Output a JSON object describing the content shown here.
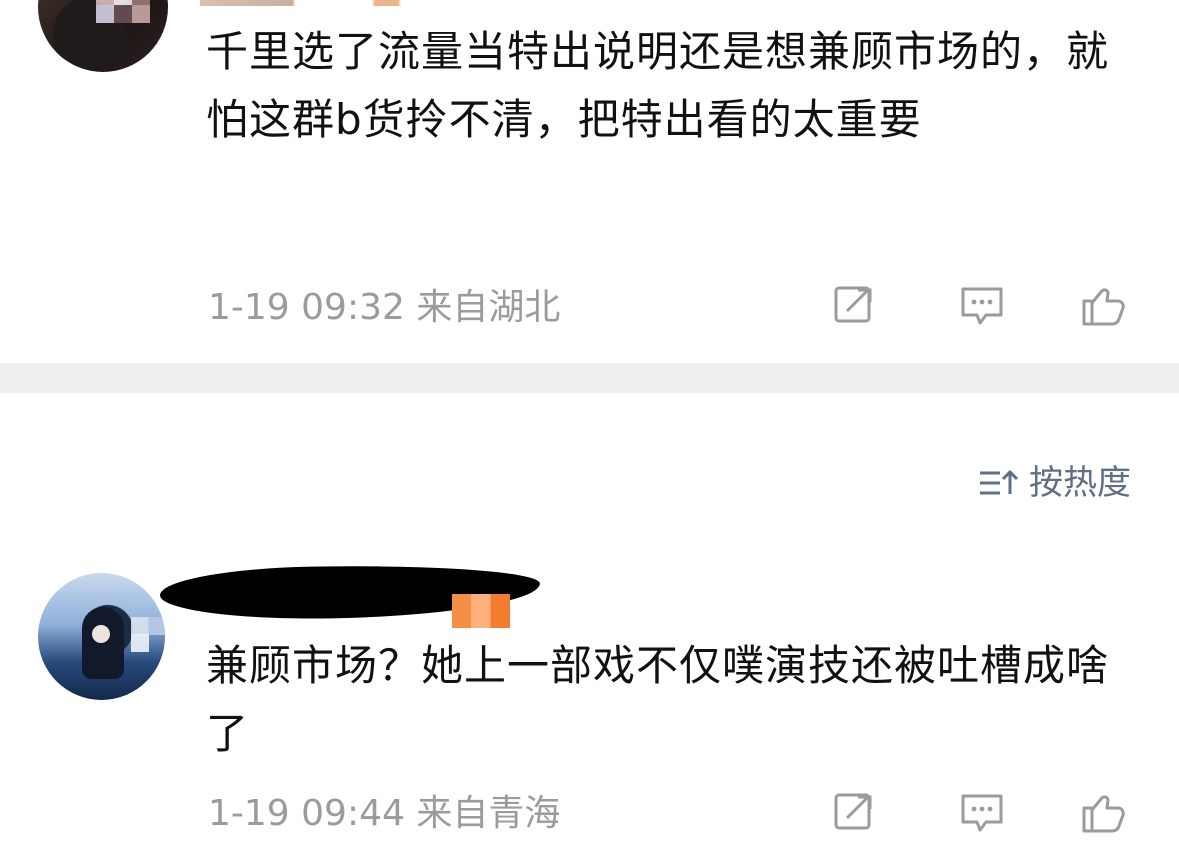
{
  "comments": [
    {
      "avatar_icon": "avatar-icon",
      "text": "千里选了流量当特出说明还是想兼顾市场的，就怕这群b货拎不清，把特出看的太重要",
      "time": "1-19 09:32",
      "location": "来自湖北",
      "actions": {
        "share_icon": "share-icon",
        "comment_icon": "comment-icon",
        "like_icon": "like-icon"
      }
    },
    {
      "avatar_icon": "avatar-icon",
      "text": "兼顾市场？她上一部戏不仅噗演技还被吐槽成啥了",
      "time": "1-19 09:44",
      "location": "来自青海",
      "actions": {
        "share_icon": "share-icon",
        "comment_icon": "comment-icon",
        "like_icon": "like-icon"
      }
    }
  ],
  "sort": {
    "label": "按热度",
    "icon": "sort-icon"
  },
  "colors": {
    "meta_gray": "#9b9b9b",
    "sort_blue_gray": "#5f6f86",
    "divider_gray": "#efefef"
  }
}
